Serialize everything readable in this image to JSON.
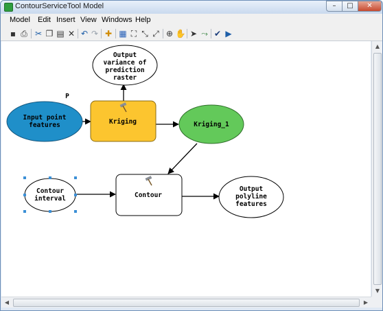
{
  "window": {
    "title": "ContourServiceTool Model",
    "minimize_glyph": "–",
    "maximize_glyph": "□",
    "close_glyph": "✕"
  },
  "menu": [
    {
      "label": "Model"
    },
    {
      "label": "Edit"
    },
    {
      "label": "Insert"
    },
    {
      "label": "View"
    },
    {
      "label": "Windows"
    },
    {
      "label": "Help"
    }
  ],
  "toolbar": [
    {
      "name": "save-icon",
      "glyph": "▪"
    },
    {
      "name": "print-icon",
      "glyph": "⎙"
    },
    {
      "name": "cut-icon",
      "glyph": "✂"
    },
    {
      "name": "copy-icon",
      "glyph": "❐"
    },
    {
      "name": "paste-icon",
      "glyph": "▤"
    },
    {
      "name": "delete-icon",
      "glyph": "✕"
    },
    {
      "name": "undo-icon",
      "glyph": "↶"
    },
    {
      "name": "redo-icon",
      "glyph": "↷"
    },
    {
      "name": "add-data-icon",
      "glyph": "✚"
    },
    {
      "name": "auto-layout-icon",
      "glyph": "▦"
    },
    {
      "name": "full-extent-icon",
      "glyph": "⛶"
    },
    {
      "name": "fixed-zoom-out-icon",
      "glyph": "⤡"
    },
    {
      "name": "fixed-zoom-in-icon",
      "glyph": "⤢"
    },
    {
      "name": "zoom-in-icon",
      "glyph": "⊕"
    },
    {
      "name": "pan-icon",
      "glyph": "✋"
    },
    {
      "name": "select-icon",
      "glyph": "➤"
    },
    {
      "name": "connect-icon",
      "glyph": "⤳"
    },
    {
      "name": "validate-icon",
      "glyph": "✔"
    },
    {
      "name": "run-icon",
      "glyph": "▶"
    }
  ],
  "colors": {
    "input_data": "#1f8fc9",
    "tool": "#fcc52f",
    "derived_data": "#63c95a",
    "selection_handle": "#3b8fd6"
  },
  "diagram": {
    "nodes": {
      "input_point_features": {
        "lines": [
          "Input point",
          "features"
        ]
      },
      "kriging": {
        "lines": [
          "Kriging"
        ]
      },
      "kriging_1": {
        "lines": [
          "Kriging_1"
        ]
      },
      "output_variance": {
        "lines": [
          "Output",
          "variance of",
          "prediction",
          "raster"
        ]
      },
      "contour_interval": {
        "lines": [
          "Contour",
          "interval"
        ]
      },
      "contour": {
        "lines": [
          "Contour"
        ]
      },
      "output_polyline": {
        "lines": [
          "Output",
          "polyline",
          "features"
        ]
      }
    },
    "parameter_marker": "P"
  }
}
